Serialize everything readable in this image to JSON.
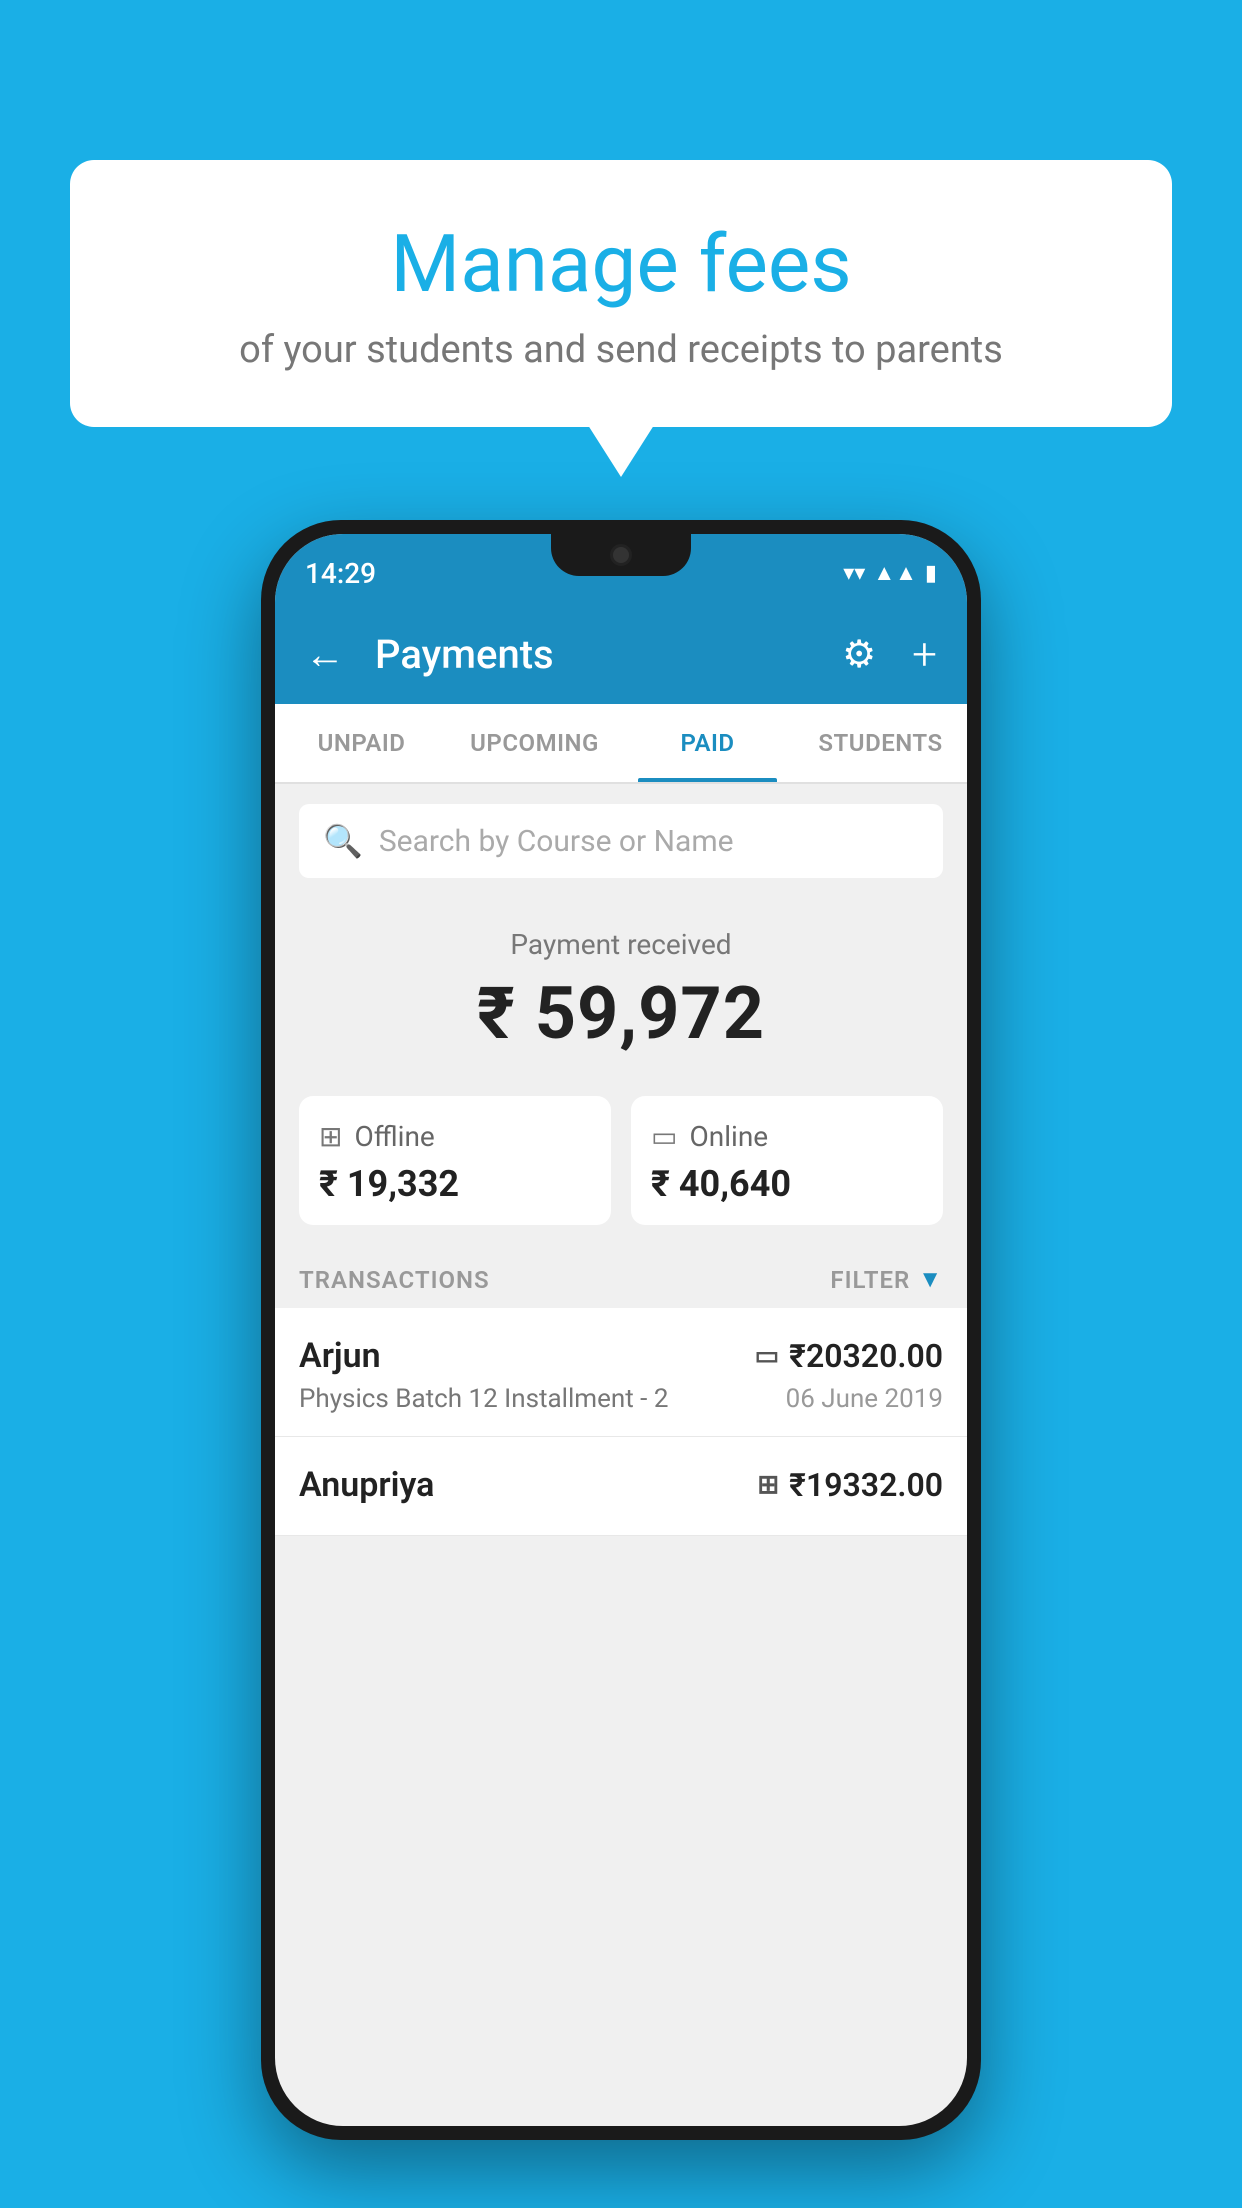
{
  "background_color": "#1AAFE6",
  "bubble": {
    "title": "Manage fees",
    "subtitle": "of your students and send receipts to parents"
  },
  "status_bar": {
    "time": "14:29",
    "wifi": "▾",
    "signal": "▲",
    "battery": "▮"
  },
  "app_bar": {
    "title": "Payments",
    "back_label": "←",
    "gear_label": "⚙",
    "plus_label": "+"
  },
  "tabs": [
    {
      "label": "UNPAID",
      "active": false
    },
    {
      "label": "UPCOMING",
      "active": false
    },
    {
      "label": "PAID",
      "active": true
    },
    {
      "label": "STUDENTS",
      "active": false
    }
  ],
  "search": {
    "placeholder": "Search by Course or Name"
  },
  "payment_summary": {
    "label": "Payment received",
    "amount": "₹ 59,972"
  },
  "payment_cards": [
    {
      "icon": "₹",
      "label": "Offline",
      "amount": "₹ 19,332"
    },
    {
      "icon": "▭",
      "label": "Online",
      "amount": "₹ 40,640"
    }
  ],
  "transactions": {
    "header_label": "TRANSACTIONS",
    "filter_label": "FILTER"
  },
  "transaction_list": [
    {
      "name": "Arjun",
      "amount": "₹20320.00",
      "payment_type_icon": "▭",
      "course": "Physics Batch 12 Installment - 2",
      "date": "06 June 2019"
    },
    {
      "name": "Anupriya",
      "amount": "₹19332.00",
      "payment_type_icon": "₹",
      "course": "",
      "date": ""
    }
  ]
}
